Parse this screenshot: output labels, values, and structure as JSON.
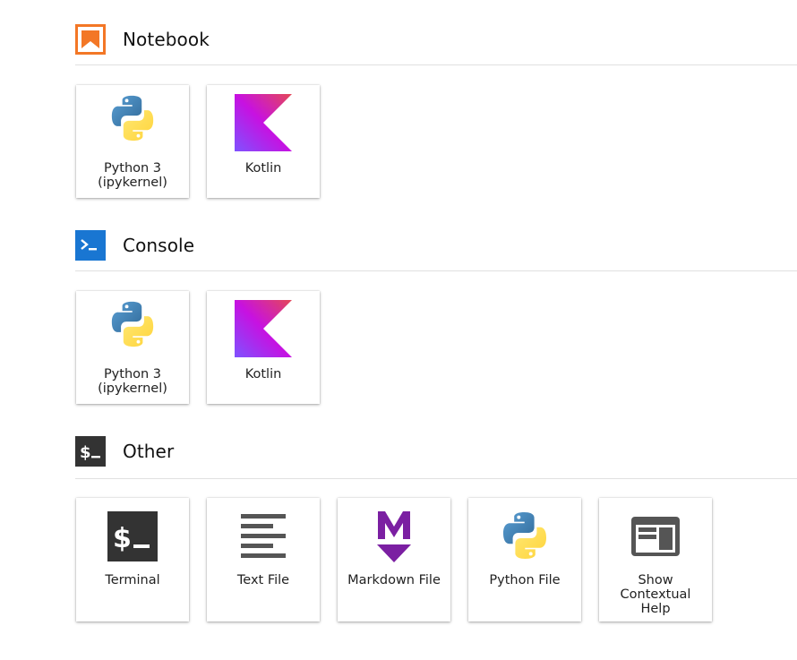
{
  "sections": [
    {
      "title": "Notebook",
      "icon": "notebook-icon",
      "cards": [
        {
          "label_line1": "Python 3",
          "label_line2": "(ipykernel)",
          "icon": "python-logo-icon"
        },
        {
          "label_line1": "Kotlin",
          "icon": "kotlin-logo-icon"
        }
      ]
    },
    {
      "title": "Console",
      "icon": "console-icon",
      "cards": [
        {
          "label_line1": "Python 3",
          "label_line2": "(ipykernel)",
          "icon": "python-logo-icon"
        },
        {
          "label_line1": "Kotlin",
          "icon": "kotlin-logo-icon"
        }
      ]
    },
    {
      "title": "Other",
      "icon": "terminal-icon",
      "cards": [
        {
          "label_line1": "Terminal",
          "icon": "terminal-icon"
        },
        {
          "label_line1": "Text File",
          "icon": "text-file-icon"
        },
        {
          "label_line1": "Markdown File",
          "icon": "markdown-icon"
        },
        {
          "label_line1": "Python File",
          "icon": "python-logo-icon"
        },
        {
          "label_line1": "Show",
          "label_line2": "Contextual",
          "label_line3": "Help",
          "icon": "contextual-help-icon"
        }
      ]
    }
  ],
  "colors": {
    "notebook_orange": "#f37726",
    "console_blue": "#1976d2",
    "terminal_dark": "#333333",
    "markdown_purple": "#7b1fa2",
    "python_blue": "#3670a0",
    "python_yellow": "#ffd43b"
  }
}
